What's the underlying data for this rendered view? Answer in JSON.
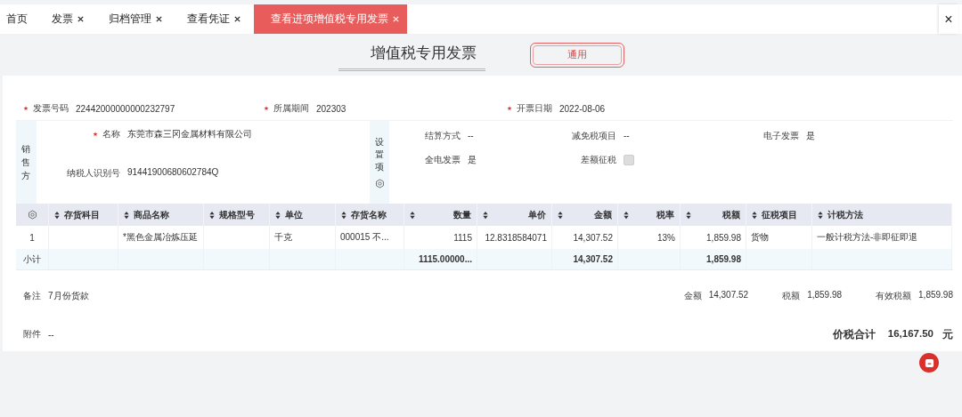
{
  "tabs": [
    {
      "label": "首页",
      "closable": false,
      "selected": false
    },
    {
      "label": "发票",
      "closable": true,
      "selected": false
    },
    {
      "label": "归档管理",
      "closable": true,
      "selected": false
    },
    {
      "label": "查看凭证",
      "closable": true,
      "selected": false
    },
    {
      "label": "查看进项增值税专用发票",
      "closable": true,
      "selected": true
    }
  ],
  "close_all": "×",
  "header": {
    "title": "增值税专用发票",
    "badge": "通用"
  },
  "fields": [
    {
      "label": "发票号码",
      "value": "22442000000000232797",
      "required": true
    },
    {
      "label": "所属期间",
      "value": "202303",
      "required": true
    },
    {
      "label": "开票日期",
      "value": "2022-08-06",
      "required": true
    }
  ],
  "seller": {
    "title": "销售方",
    "fields": [
      {
        "label": "名称",
        "value": "东莞市森三冈金属材料有限公司",
        "required": true
      },
      {
        "label": "纳税人识别号",
        "value": "91441900680602784Q",
        "required": false
      }
    ]
  },
  "settings": {
    "title": "设置项",
    "items": [
      {
        "kind": "text",
        "label": "结算方式",
        "value": "--"
      },
      {
        "kind": "text",
        "label": "减免税项目",
        "value": "--"
      },
      {
        "kind": "text",
        "label": "电子发票",
        "value": "是"
      },
      {
        "kind": "text",
        "label": "全电发票",
        "value": "是"
      },
      {
        "kind": "checkbox",
        "label": "差额征税",
        "checked": false
      }
    ]
  },
  "table": {
    "columns": [
      {
        "kind": "settings"
      },
      {
        "kind": "sort",
        "label": "存货科目"
      },
      {
        "kind": "sort",
        "label": "商品名称"
      },
      {
        "kind": "sort",
        "label": "规格型号"
      },
      {
        "kind": "sort",
        "label": "单位"
      },
      {
        "kind": "sort",
        "label": "存货名称"
      },
      {
        "kind": "sort",
        "label": "数量"
      },
      {
        "kind": "sort",
        "label": "单价"
      },
      {
        "kind": "sort",
        "label": "金额"
      },
      {
        "kind": "sort",
        "label": "税率"
      },
      {
        "kind": "sort",
        "label": "税额"
      },
      {
        "kind": "sort",
        "label": "征税项目"
      },
      {
        "kind": "sort",
        "label": "计税方法"
      }
    ],
    "rows": [
      {
        "index": "1",
        "product": "*黑色金属冶炼压延",
        "unit": "千克",
        "stock_name": "000015 不...",
        "quantity": "1115",
        "price": "12.8318584071",
        "amount": "14,307.52",
        "rate": "13%",
        "tax": "1,859.98",
        "tax_item": "货物",
        "method": "一般计税方法-非即征即退"
      }
    ],
    "subtotal": {
      "index": "小计",
      "quantity": "1115.00000...",
      "amount": "14,307.52",
      "tax": "1,859.98"
    }
  },
  "remark": {
    "label": "备注",
    "value": "7月份货款"
  },
  "totals": [
    {
      "label": "金额",
      "value": "14,307.52"
    },
    {
      "label": "税额",
      "value": "1,859.98"
    },
    {
      "label": "有效税额",
      "value": "1,859.98"
    }
  ],
  "attachment": {
    "label": "附件",
    "value": "--"
  },
  "grand_total": {
    "label": "价税合计",
    "value": "16,167.50",
    "unit": "元"
  }
}
